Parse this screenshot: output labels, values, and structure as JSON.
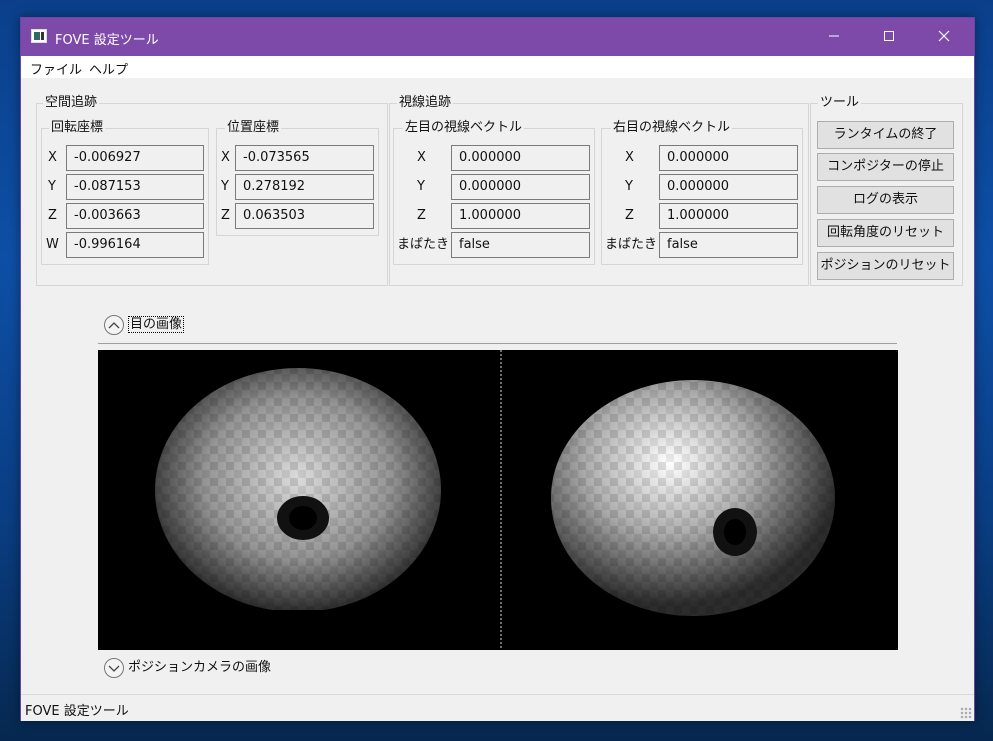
{
  "window": {
    "title": "FOVE 設定ツール",
    "controls": {
      "minimize": "—",
      "maximize": "☐",
      "close": "✕"
    }
  },
  "menu": [
    "ファイル",
    "ヘルプ"
  ],
  "spatial_tracking": {
    "label": "空間追跡",
    "rotation": {
      "label": "回転座標",
      "rows": [
        {
          "axis": "X",
          "value": "-0.006927"
        },
        {
          "axis": "Y",
          "value": "-0.087153"
        },
        {
          "axis": "Z",
          "value": "-0.003663"
        },
        {
          "axis": "W",
          "value": "-0.996164"
        }
      ]
    },
    "position": {
      "label": "位置座標",
      "rows": [
        {
          "axis": "X",
          "value": "-0.073565"
        },
        {
          "axis": "Y",
          "value": "0.278192"
        },
        {
          "axis": "Z",
          "value": "0.063503"
        }
      ]
    }
  },
  "gaze_tracking": {
    "label": "視線追跡",
    "left": {
      "label": "左目の視線ベクトル",
      "rows": [
        {
          "axis": "X",
          "value": "0.000000"
        },
        {
          "axis": "Y",
          "value": "0.000000"
        },
        {
          "axis": "Z",
          "value": "1.000000"
        },
        {
          "axis": "まばたき",
          "value": "false"
        }
      ]
    },
    "right": {
      "label": "右目の視線ベクトル",
      "rows": [
        {
          "axis": "X",
          "value": "0.000000"
        },
        {
          "axis": "Y",
          "value": "0.000000"
        },
        {
          "axis": "Z",
          "value": "1.000000"
        },
        {
          "axis": "まばたき",
          "value": "false"
        }
      ]
    }
  },
  "tools": {
    "label": "ツール",
    "buttons": [
      "ランタイムの終了",
      "コンポジターの停止",
      "ログの表示",
      "回転角度のリセット",
      "ポジションのリセット"
    ]
  },
  "eye_images": {
    "label": "目の画像",
    "expanded": true
  },
  "position_camera": {
    "label": "ポジションカメラの画像",
    "expanded": false
  },
  "status": {
    "text": "FOVE 設定ツール"
  }
}
